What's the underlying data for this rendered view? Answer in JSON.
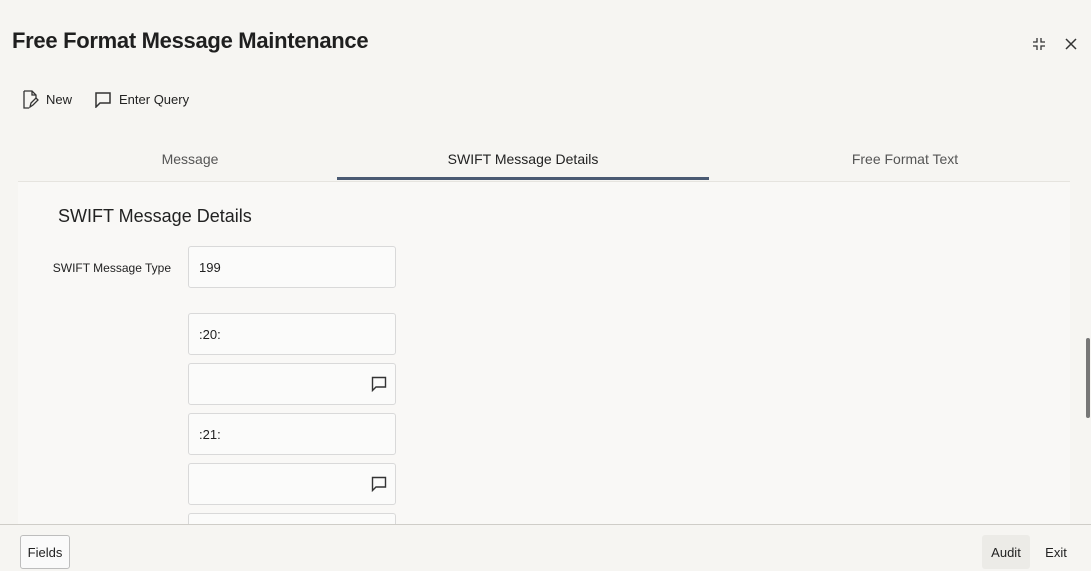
{
  "window": {
    "title": "Free Format Message Maintenance"
  },
  "toolbar": {
    "new_label": "New",
    "enter_query_label": "Enter Query"
  },
  "tabs": [
    {
      "label": "Message",
      "active": false
    },
    {
      "label": "SWIFT Message Details",
      "active": true
    },
    {
      "label": "Free Format Text",
      "active": false
    }
  ],
  "section": {
    "title": "SWIFT Message Details",
    "message_type_label": "SWIFT Message Type",
    "message_type_value": "199",
    "fields": [
      {
        "value": ":20:"
      },
      {
        "value": ""
      },
      {
        "value": ":21:"
      },
      {
        "value": ""
      }
    ]
  },
  "footer": {
    "fields_label": "Fields",
    "audit_label": "Audit",
    "exit_label": "Exit"
  },
  "colors": {
    "active_tab_underline": "#4a5a73",
    "background": "#f6f5f2"
  }
}
